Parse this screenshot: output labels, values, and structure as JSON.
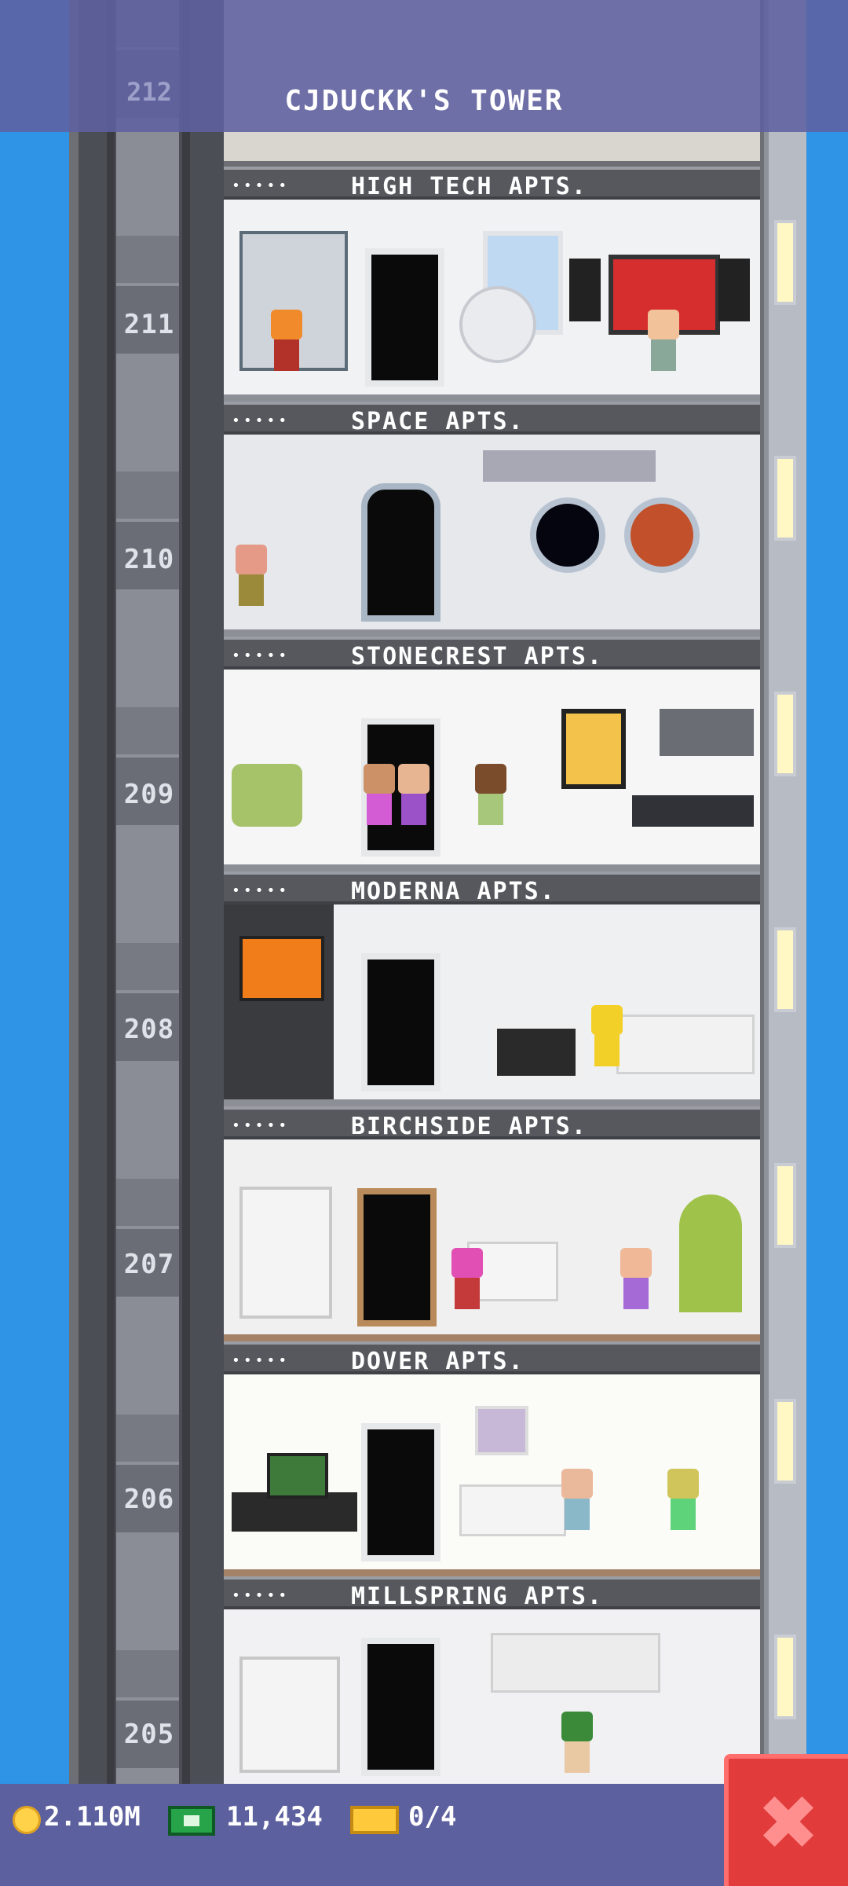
{
  "tower_title": "CJDUCKK'S TOWER",
  "top_floor_number": "212",
  "floors": [
    {
      "number": "211",
      "name": "HIGH TECH APTS.",
      "stars": "•••••"
    },
    {
      "number": "210",
      "name": "SPACE APTS.",
      "stars": "•••••"
    },
    {
      "number": "209",
      "name": "STONECREST APTS.",
      "stars": "•••••"
    },
    {
      "number": "208",
      "name": "MODERNA APTS.",
      "stars": "•••••"
    },
    {
      "number": "207",
      "name": "BIRCHSIDE APTS.",
      "stars": "•••••"
    },
    {
      "number": "206",
      "name": "DOVER APTS.",
      "stars": "•••••"
    },
    {
      "number": "205",
      "name": "MILLSPRING APTS.",
      "stars": "•••••"
    }
  ],
  "status": {
    "coins": "2.110M",
    "bux": "11,434",
    "tickets": "0/4"
  },
  "icons": {
    "coins": "coin-icon",
    "bux": "cash-icon",
    "tickets": "ticket-icon",
    "close": "close-icon"
  },
  "close_label": "✖"
}
